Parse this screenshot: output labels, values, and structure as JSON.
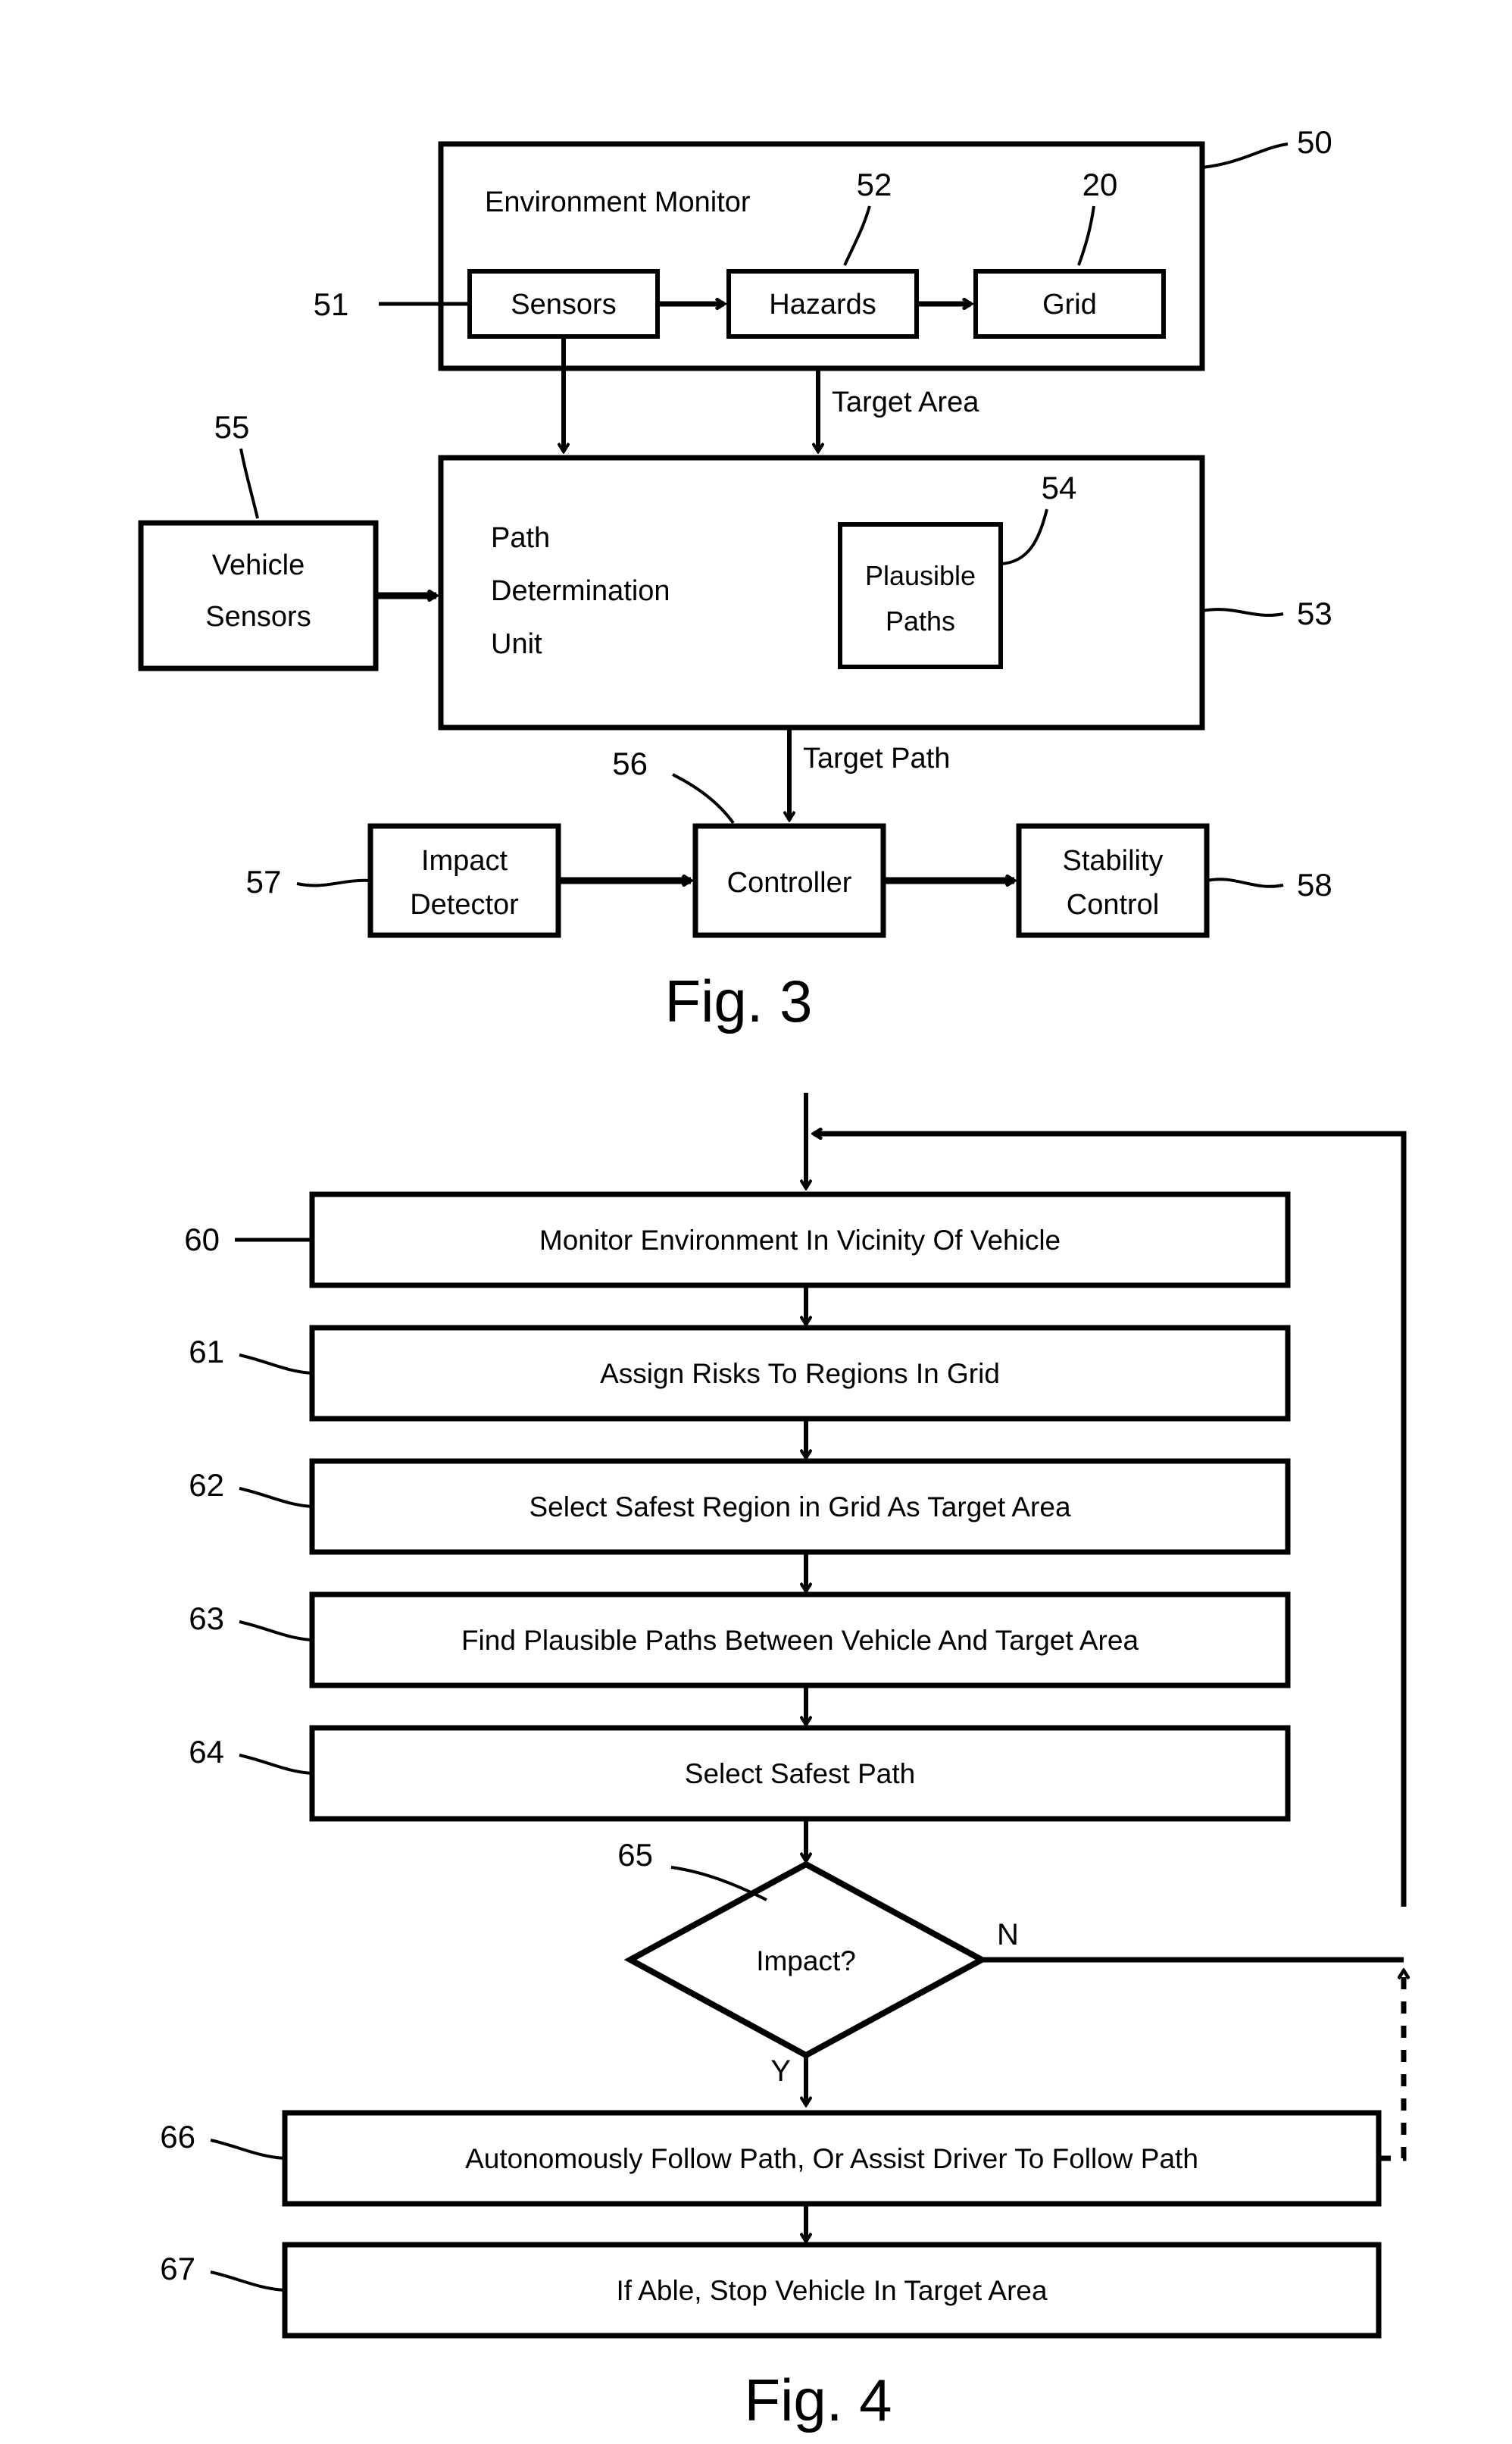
{
  "document": {
    "kind": "patent-drawing-sheet",
    "background_color": "#ffffff",
    "ink_color": "#000000"
  },
  "figures": [
    {
      "id": "fig3",
      "caption": "Fig. 3",
      "type": "block-diagram",
      "blocks": [
        {
          "key": "environment_monitor",
          "label": "Environment Monitor",
          "ref": "50"
        },
        {
          "key": "sensors",
          "label": "Sensors",
          "ref": "51"
        },
        {
          "key": "hazards",
          "label": "Hazards",
          "ref": "52"
        },
        {
          "key": "grid",
          "label": "Grid",
          "ref": "20"
        },
        {
          "key": "vehicle_sensors",
          "label_line1": "Vehicle",
          "label_line2": "Sensors",
          "ref": "55"
        },
        {
          "key": "path_determination_unit",
          "label_line1": "Path",
          "label_line2": "Determination",
          "label_line3": "Unit",
          "ref": "53"
        },
        {
          "key": "plausible_paths",
          "label_line1": "Plausible",
          "label_line2": "Paths",
          "ref": "54"
        },
        {
          "key": "impact_detector",
          "label_line1": "Impact",
          "label_line2": "Detector",
          "ref": "57"
        },
        {
          "key": "controller",
          "label": "Controller",
          "ref": "56"
        },
        {
          "key": "stability_control",
          "label_line1": "Stability",
          "label_line2": "Control",
          "ref": "58"
        }
      ],
      "edge_labels": [
        {
          "key": "target_area",
          "label": "Target Area"
        },
        {
          "key": "target_path",
          "label": "Target Path"
        }
      ]
    },
    {
      "id": "fig4",
      "caption": "Fig. 4",
      "type": "flowchart",
      "steps": [
        {
          "ref": "60",
          "label": "Monitor Environment In Vicinity Of Vehicle"
        },
        {
          "ref": "61",
          "label": "Assign Risks To Regions In Grid"
        },
        {
          "ref": "62",
          "label": "Select Safest Region in Grid As Target Area"
        },
        {
          "ref": "63",
          "label": "Find Plausible Paths Between Vehicle And Target Area"
        },
        {
          "ref": "64",
          "label": "Select Safest Path"
        }
      ],
      "decision": {
        "ref": "65",
        "label": "Impact?",
        "yes_label": "Y",
        "no_label": "N"
      },
      "post_steps": [
        {
          "ref": "66",
          "label": "Autonomously Follow Path, Or Assist Driver To Follow Path"
        },
        {
          "ref": "67",
          "label": "If Able, Stop Vehicle In Target Area"
        }
      ]
    }
  ]
}
